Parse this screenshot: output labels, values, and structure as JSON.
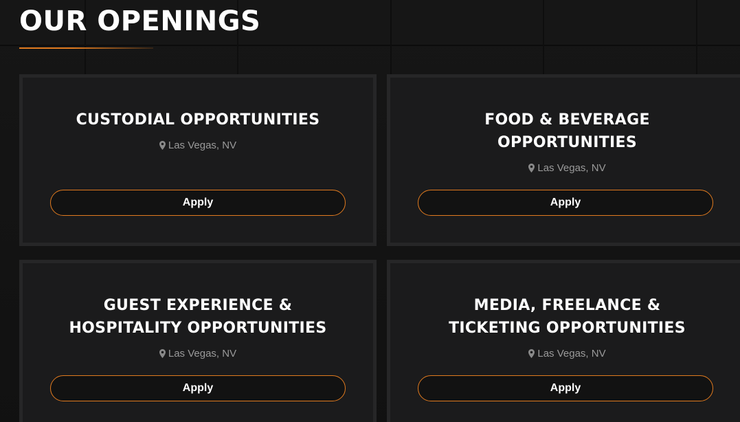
{
  "section": {
    "title": "OUR OPENINGS"
  },
  "colors": {
    "accent": "#e07a1f",
    "background": "#161616",
    "card": "#1b1b1c",
    "card_border": "#262627",
    "text": "#ffffff",
    "muted": "#9a9a9a"
  },
  "openings": [
    {
      "title": "CUSTODIAL OPPORTUNITIES",
      "location_icon": "map-pin-icon",
      "location": "Las Vegas, NV",
      "apply_label": "Apply"
    },
    {
      "title": "FOOD & BEVERAGE\nOPPORTUNITIES",
      "location_icon": "map-pin-icon",
      "location": "Las Vegas, NV",
      "apply_label": "Apply"
    },
    {
      "title": "GUEST EXPERIENCE &\nHOSPITALITY OPPORTUNITIES",
      "location_icon": "map-pin-icon",
      "location": "Las Vegas, NV",
      "apply_label": "Apply"
    },
    {
      "title": "MEDIA, FREELANCE &\nTICKETING OPPORTUNITIES",
      "location_icon": "map-pin-icon",
      "location": "Las Vegas, NV",
      "apply_label": "Apply"
    }
  ]
}
